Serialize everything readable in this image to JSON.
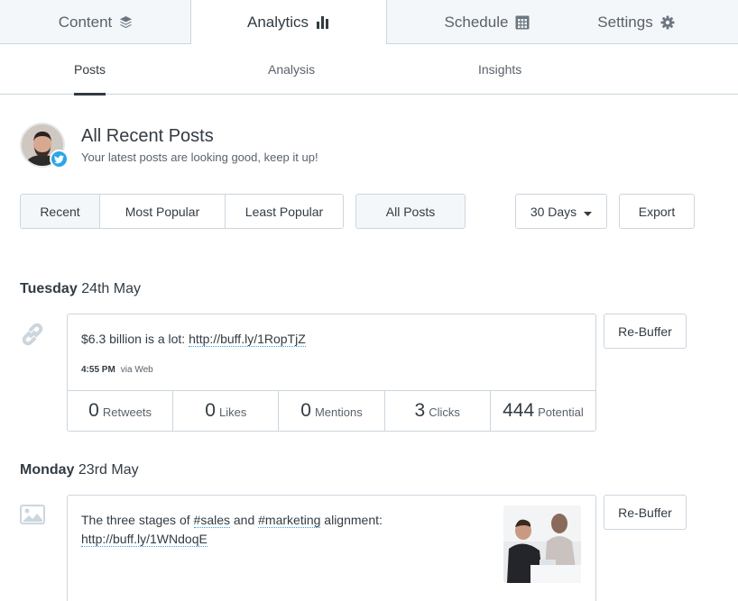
{
  "top_tabs": [
    {
      "label": "Content",
      "icon": "layers-icon"
    },
    {
      "label": "Analytics",
      "icon": "bar-chart-icon"
    },
    {
      "label": "Schedule",
      "icon": "calendar-icon"
    },
    {
      "label": "Settings",
      "icon": "gear-icon"
    }
  ],
  "sub_tabs": [
    {
      "label": "Posts"
    },
    {
      "label": "Analysis"
    },
    {
      "label": "Insights"
    }
  ],
  "profile": {
    "title": "All Recent Posts",
    "subtitle": "Your latest posts are looking good, keep it up!",
    "network_icon": "twitter-icon"
  },
  "filters": {
    "sort": [
      "Recent",
      "Most Popular",
      "Least Popular"
    ],
    "type": "All Posts",
    "range": "30 Days",
    "export": "Export"
  },
  "days": [
    {
      "weekday": "Tuesday",
      "date": "24th May",
      "posts": [
        {
          "type_icon": "link-icon",
          "text": "$6.3 billion is a lot: ",
          "link": "http://buff.ly/1RopTjZ",
          "time": "4:55 PM",
          "via": "via Web",
          "stats": [
            {
              "num": "0",
              "label": "Retweets"
            },
            {
              "num": "0",
              "label": "Likes"
            },
            {
              "num": "0",
              "label": "Mentions"
            },
            {
              "num": "3",
              "label": "Clicks"
            },
            {
              "num": "444",
              "label": "Potential"
            }
          ],
          "action": "Re-Buffer"
        }
      ]
    },
    {
      "weekday": "Monday",
      "date": "23rd May",
      "posts": [
        {
          "type_icon": "image-icon",
          "text_parts": [
            "The three stages of ",
            "#sales",
            " and ",
            "#marketing",
            " alignment:"
          ],
          "link": "http://buff.ly/1WNdoqE",
          "action": "Re-Buffer"
        }
      ]
    }
  ],
  "colors": {
    "accent": "#2ba6e6",
    "border": "#ccd6dd",
    "tab_bg": "#f4f7f9",
    "text": "#323b43",
    "muted": "#59626a"
  }
}
